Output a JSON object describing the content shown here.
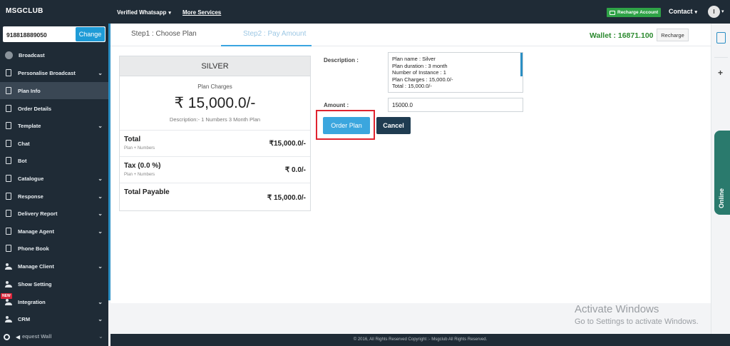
{
  "topbar": {
    "brand": "MSGCLUB",
    "verified": "Verified Whatsapp",
    "more": "More Services",
    "recharge_account": "Recharge Account",
    "contact": "Contact",
    "avatar_initial": "I"
  },
  "sidebar": {
    "phone": "918818889050",
    "change": "Change",
    "items": [
      {
        "label": "Broadcast"
      },
      {
        "label": "Personalise Broadcast"
      },
      {
        "label": "Plan Info"
      },
      {
        "label": "Order Details"
      },
      {
        "label": "Template"
      },
      {
        "label": "Chat"
      },
      {
        "label": "Bot"
      },
      {
        "label": "Catalogue"
      },
      {
        "label": "Response"
      },
      {
        "label": "Delivery Report"
      },
      {
        "label": "Manage Agent"
      },
      {
        "label": "Phone Book"
      },
      {
        "label": "Manage Client"
      },
      {
        "label": "Show Setting"
      },
      {
        "label": "Integration"
      },
      {
        "label": "CRM"
      }
    ],
    "new_badge": "NEW",
    "bottom_item": "equest Wall"
  },
  "steps": {
    "step1": "Step1 : Choose Plan",
    "step2": "Step2 : Pay Amount"
  },
  "wallet": {
    "label": "Wallet : 16871.100",
    "recharge": "Recharge"
  },
  "plan": {
    "name": "SILVER",
    "charges_label": "Plan Charges",
    "price": "₹ 15,000.0/-",
    "description": "Description:- 1 Numbers 3 Month Plan",
    "rows": [
      {
        "title": "Total",
        "sub": "Plan + Numbers",
        "value": "₹15,000.0/-"
      },
      {
        "title": "Tax (0.0 %)",
        "sub": "Plan + Numbers",
        "value": "₹ 0.0/-"
      },
      {
        "title": "Total Payable",
        "sub": "",
        "value": "₹ 15,000.0/-"
      }
    ]
  },
  "form": {
    "description_label": "Description :",
    "description_lines": [
      "Plan name : Silver",
      "Plan duration : 3 month",
      "Number of Instance : 1",
      "Plan Charges : 15,000.0/-",
      "Total : 15,000.0/-"
    ],
    "amount_label": "Amount :",
    "amount_value": "15000.0",
    "order_button": "Order Plan",
    "cancel_button": "Cancel"
  },
  "right_strip": {
    "online": "Online"
  },
  "watermark": {
    "line1": "Activate Windows",
    "line2": "Go to Settings to activate Windows."
  },
  "footer": {
    "text": "© 2016, All Rights Reserved Copyright :- Msgclub All Rights Reserved."
  },
  "colors": {
    "sidebar_bg": "#1f2b36",
    "accent_blue": "#3ba6de",
    "wallet_green": "#2c8a2f",
    "highlight_red": "#e0232f",
    "cancel_bg": "#1f3c51"
  }
}
